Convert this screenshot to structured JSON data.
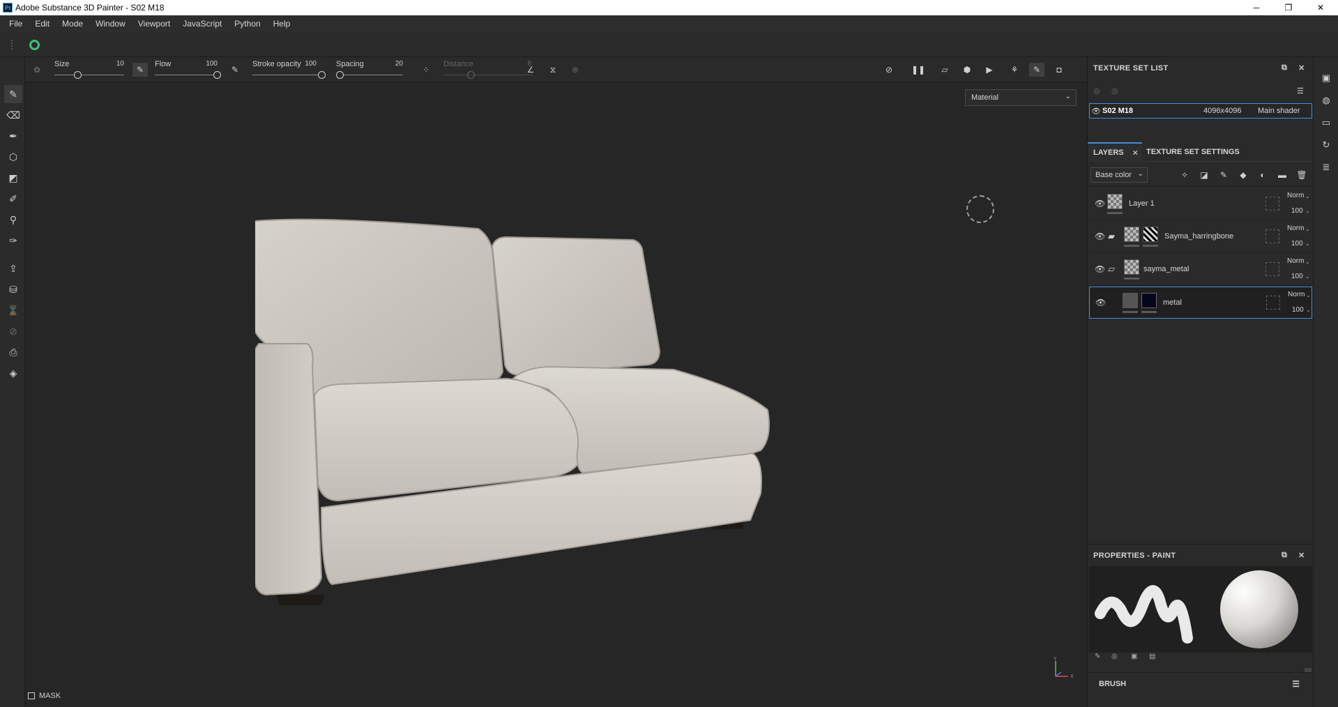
{
  "window": {
    "logo_text": "Pt",
    "title": "Adobe Substance 3D Painter - S02 M18",
    "minimize": "─",
    "maximize": "❐",
    "close": "✕"
  },
  "menu": [
    "File",
    "Edit",
    "Mode",
    "Window",
    "Viewport",
    "JavaScript",
    "Python",
    "Help"
  ],
  "tool_options": {
    "size_label": "Size",
    "size_value": "10",
    "flow_label": "Flow",
    "flow_value": "100",
    "stroke_opacity_label": "Stroke opacity",
    "stroke_opacity_value": "100",
    "spacing_label": "Spacing",
    "spacing_value": "20",
    "distance_label": "Distance",
    "distance_value": "8"
  },
  "viewport": {
    "material_mode": "Material",
    "mask_label": "MASK",
    "axis_y": "Y",
    "axis_x": "X"
  },
  "texture_set_list": {
    "title": "TEXTURE SET LIST",
    "item": {
      "name": "S02 M18",
      "resolution": "4096x4096",
      "shader": "Main shader"
    }
  },
  "tabs": {
    "layers": "LAYERS",
    "texture_set_settings": "TEXTURE SET SETTINGS"
  },
  "channel": "Base color",
  "layers": [
    {
      "name": "Layer 1",
      "blend": "Norm",
      "opacity": "100"
    },
    {
      "name": "Sayma_harringbone",
      "blend": "Norm",
      "opacity": "100"
    },
    {
      "name": "sayma_metal",
      "blend": "Norm",
      "opacity": "100"
    },
    {
      "name": "metal",
      "blend": "Norm",
      "opacity": "100"
    }
  ],
  "properties": {
    "title": "PROPERTIES - PAINT",
    "brush_label": "BRUSH"
  },
  "colors": {
    "accent": "#3e8ede",
    "background": "#262626",
    "panel": "#2a2a2a",
    "sofa": "#cfcac4"
  },
  "icons": [
    "brush-icon",
    "eraser-icon",
    "projection-icon",
    "geometry-fill-icon",
    "polygon-fill-icon",
    "smudge-icon",
    "clone-icon",
    "color-picker-icon",
    "export-icon",
    "bake-icon",
    "eye-icon",
    "folder-icon",
    "trash-icon",
    "camera-icon",
    "pause-icon"
  ]
}
